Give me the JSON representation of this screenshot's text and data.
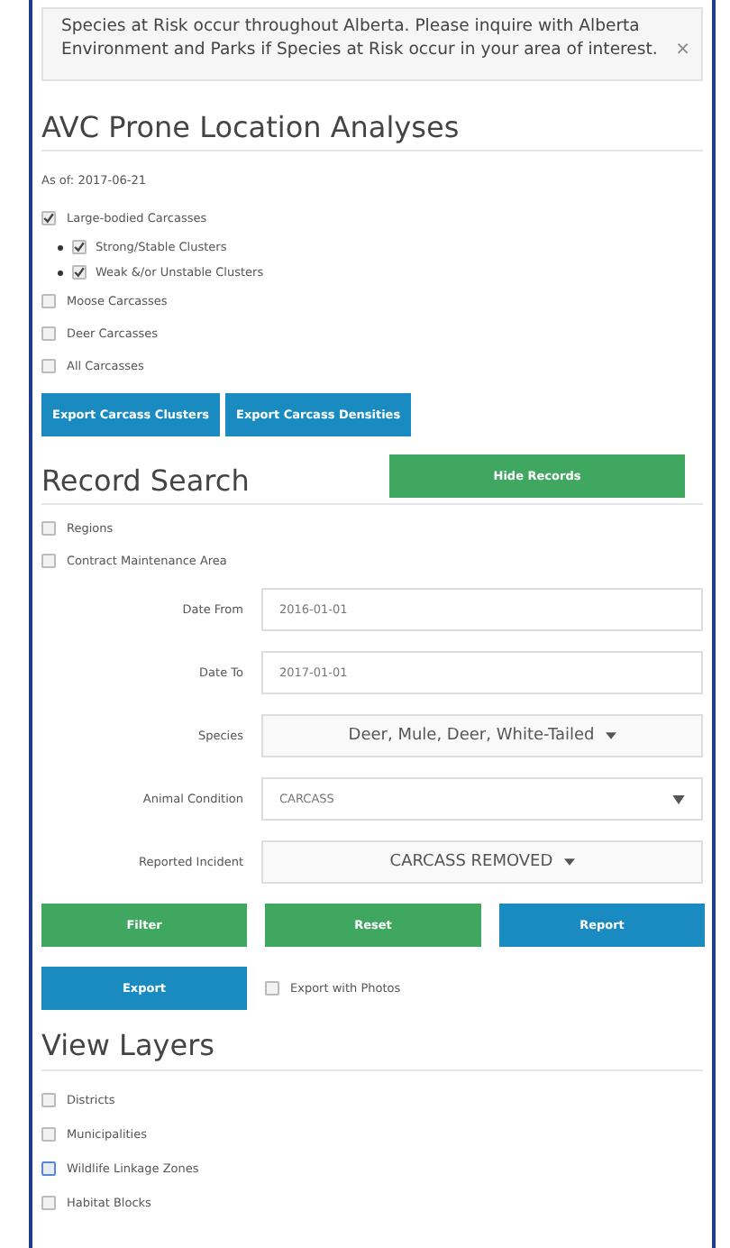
{
  "alert": {
    "text": "Species at Risk occur throughout Alberta. Please inquire with Alberta Environment and Parks if Species at Risk occur in your area of interest.",
    "close": "×"
  },
  "avc": {
    "title": "AVC Prone Location Analyses",
    "as_of": "As of: 2017-06-21",
    "options": [
      {
        "label": "Large-bodied Carcasses",
        "checked": true,
        "children": [
          {
            "label": "Strong/Stable Clusters",
            "checked": true
          },
          {
            "label": "Weak &/or Unstable Clusters",
            "checked": true
          }
        ]
      },
      {
        "label": "Moose Carcasses",
        "checked": false
      },
      {
        "label": "Deer Carcasses",
        "checked": false
      },
      {
        "label": "All Carcasses",
        "checked": false
      }
    ],
    "buttons": [
      "Export Carcass Clusters",
      "Export Carcass Densities"
    ]
  },
  "record_search": {
    "title": "Record Search",
    "toggle_button": "Hide Records",
    "areas": [
      {
        "label": "Regions",
        "checked": false
      },
      {
        "label": "Contract Maintenance Area",
        "checked": false
      }
    ],
    "fields": [
      {
        "kind": "input",
        "label": "Date From",
        "value": "2016-01-01"
      },
      {
        "kind": "input",
        "label": "Date To",
        "value": "2017-01-01"
      },
      {
        "kind": "multiselect",
        "label": "Species",
        "value": "Deer, Mule,  Deer, White-Tailed"
      },
      {
        "kind": "select",
        "label": "Animal Condition",
        "value": "CARCASS"
      },
      {
        "kind": "multiselect",
        "label": "Reported Incident",
        "value": "CARCASS REMOVED"
      }
    ],
    "actions": [
      {
        "label": "Filter",
        "kind": "success"
      },
      {
        "label": "Reset",
        "kind": "success"
      },
      {
        "label": "Report",
        "kind": "primary"
      },
      {
        "label": "Export",
        "kind": "primary"
      }
    ],
    "export_photos": {
      "label": "Export with Photos",
      "checked": false
    }
  },
  "layers": {
    "title": "View Layers",
    "items": [
      {
        "label": "Districts",
        "checked": false,
        "focused": false
      },
      {
        "label": "Municipalities",
        "checked": false,
        "focused": false
      },
      {
        "label": "Wildlife Linkage Zones",
        "checked": false,
        "focused": true
      },
      {
        "label": "Habitat Blocks",
        "checked": false,
        "focused": false
      }
    ]
  }
}
